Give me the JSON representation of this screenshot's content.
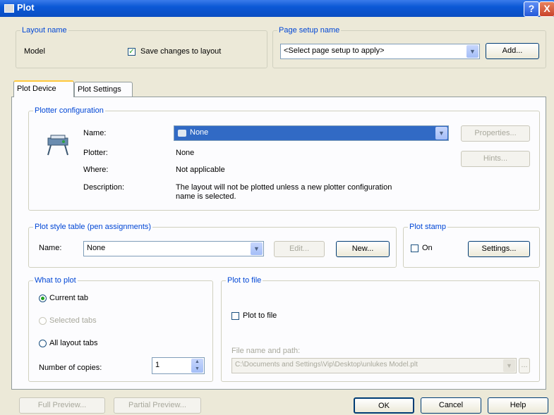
{
  "window": {
    "title": "Plot",
    "help_label": "?",
    "close_label": "X"
  },
  "layout_name": {
    "legend": "Layout name",
    "value": "Model",
    "save_changes_label": "Save changes to layout",
    "save_changes_checked": true
  },
  "page_setup": {
    "legend": "Page setup name",
    "selected": "<Select page setup to apply>",
    "add_label": "Add..."
  },
  "tabs": [
    {
      "label": "Plot Device",
      "active": true
    },
    {
      "label": "Plot Settings",
      "active": false
    }
  ],
  "plotter": {
    "legend": "Plotter configuration",
    "name_label": "Name:",
    "name_selected": "None",
    "properties_label": "Properties...",
    "hints_label": "Hints...",
    "plotter_label": "Plotter:",
    "plotter_value": "None",
    "where_label": "Where:",
    "where_value": "Not applicable",
    "description_label": "Description:",
    "description_line1": "The layout will not be plotted unless a new plotter configuration",
    "description_line2": "name is selected."
  },
  "plot_style": {
    "legend": "Plot style table (pen assignments)",
    "name_label": "Name:",
    "name_selected": "None",
    "edit_label": "Edit...",
    "new_label": "New..."
  },
  "plot_stamp": {
    "legend": "Plot stamp",
    "on_label": "On",
    "on_checked": false,
    "settings_label": "Settings..."
  },
  "what_to_plot": {
    "legend": "What to plot",
    "current_tab_label": "Current tab",
    "selected_tabs_label": "Selected tabs",
    "all_layout_tabs_label": "All layout tabs",
    "selected": "current_tab",
    "copies_label": "Number of copies:",
    "copies_value": "1"
  },
  "plot_to_file": {
    "legend": "Plot to file",
    "checkbox_label": "Plot to file",
    "checked": false,
    "path_label": "File name and path:",
    "path_value": "C:\\Documents and Settings\\Vip\\Desktop\\unlukes Model.plt",
    "browse_label": "..."
  },
  "footer": {
    "full_preview_label": "Full Preview...",
    "partial_preview_label": "Partial Preview...",
    "ok_label": "OK",
    "cancel_label": "Cancel",
    "help_label": "Help"
  },
  "colors": {
    "title_bar": "#0a4ec2",
    "legend_text": "#0046d5",
    "selection": "#316ac5",
    "tab_highlight": "#ffc83c"
  }
}
